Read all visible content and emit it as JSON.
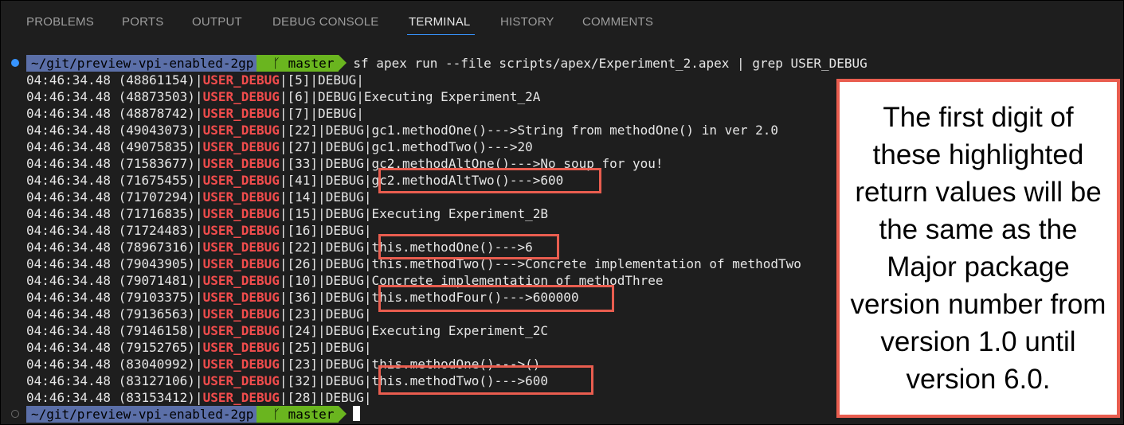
{
  "panel_tabs": [
    {
      "label": "PROBLEMS"
    },
    {
      "label": "PORTS"
    },
    {
      "label": "OUTPUT"
    },
    {
      "label": "DEBUG CONSOLE"
    },
    {
      "label": "TERMINAL",
      "active": true
    },
    {
      "label": "HISTORY"
    },
    {
      "label": "COMMENTS"
    }
  ],
  "prompt": {
    "path": "~/git/preview-vpi-enabled-2gp",
    "branch_icon": "git-branch-icon",
    "branch_glyph": "ᚴ",
    "branch": "master",
    "command": "sf apex run --file scripts/apex/Experiment_2.apex | grep USER_DEBUG"
  },
  "log_lines": [
    {
      "ts": "04:46:34.48 (48861154)|",
      "tag": "USER_DEBUG",
      "rest": "|[5]|DEBUG|"
    },
    {
      "ts": "04:46:34.48 (48873503)|",
      "tag": "USER_DEBUG",
      "rest": "|[6]|DEBUG|Executing Experiment_2A"
    },
    {
      "ts": "04:46:34.48 (48878742)|",
      "tag": "USER_DEBUG",
      "rest": "|[7]|DEBUG|"
    },
    {
      "ts": "04:46:34.48 (49043073)|",
      "tag": "USER_DEBUG",
      "rest": "|[22]|DEBUG|gc1.methodOne()--->String from methodOne() in ver 2.0"
    },
    {
      "ts": "04:46:34.48 (49075835)|",
      "tag": "USER_DEBUG",
      "rest": "|[27]|DEBUG|gc1.methodTwo()--->20"
    },
    {
      "ts": "04:46:34.48 (71583677)|",
      "tag": "USER_DEBUG",
      "rest": "|[33]|DEBUG|gc2.methodAltOne()--->No soup for you!"
    },
    {
      "ts": "04:46:34.48 (71675455)|",
      "tag": "USER_DEBUG",
      "rest": "|[41]|DEBUG|gc2.methodAltTwo()--->600"
    },
    {
      "ts": "04:46:34.48 (71707294)|",
      "tag": "USER_DEBUG",
      "rest": "|[14]|DEBUG|"
    },
    {
      "ts": "04:46:34.48 (71716835)|",
      "tag": "USER_DEBUG",
      "rest": "|[15]|DEBUG|Executing Experiment_2B"
    },
    {
      "ts": "04:46:34.48 (71724483)|",
      "tag": "USER_DEBUG",
      "rest": "|[16]|DEBUG|"
    },
    {
      "ts": "04:46:34.48 (78967316)|",
      "tag": "USER_DEBUG",
      "rest": "|[22]|DEBUG|this.methodOne()--->6"
    },
    {
      "ts": "04:46:34.48 (79043905)|",
      "tag": "USER_DEBUG",
      "rest": "|[26]|DEBUG|this.methodTwo()--->Concrete implementation of methodTwo"
    },
    {
      "ts": "04:46:34.48 (79071481)|",
      "tag": "USER_DEBUG",
      "rest": "|[10]|DEBUG|Concrete implementation of methodThree"
    },
    {
      "ts": "04:46:34.48 (79103375)|",
      "tag": "USER_DEBUG",
      "rest": "|[36]|DEBUG|this.methodFour()--->600000"
    },
    {
      "ts": "04:46:34.48 (79136563)|",
      "tag": "USER_DEBUG",
      "rest": "|[23]|DEBUG|"
    },
    {
      "ts": "04:46:34.48 (79146158)|",
      "tag": "USER_DEBUG",
      "rest": "|[24]|DEBUG|Executing Experiment_2C"
    },
    {
      "ts": "04:46:34.48 (79152765)|",
      "tag": "USER_DEBUG",
      "rest": "|[25]|DEBUG|"
    },
    {
      "ts": "04:46:34.48 (83040992)|",
      "tag": "USER_DEBUG",
      "rest": "|[23]|DEBUG|this.methodOne()--->()"
    },
    {
      "ts": "04:46:34.48 (83127106)|",
      "tag": "USER_DEBUG",
      "rest": "|[32]|DEBUG|this.methodTwo()--->600"
    },
    {
      "ts": "04:46:34.48 (83153412)|",
      "tag": "USER_DEBUG",
      "rest": "|[28]|DEBUG|"
    }
  ],
  "callout": {
    "text": "The first digit of these highlighted return values will be the same as the Major package version number from version 1.0 until version 6.0."
  },
  "colors": {
    "accent_tab": "#3794ff",
    "debug_tag": "#f14c4c",
    "highlight_border": "#e95d4f",
    "path_segment": "#5b6fa8",
    "branch_segment": "#6ab51f"
  }
}
